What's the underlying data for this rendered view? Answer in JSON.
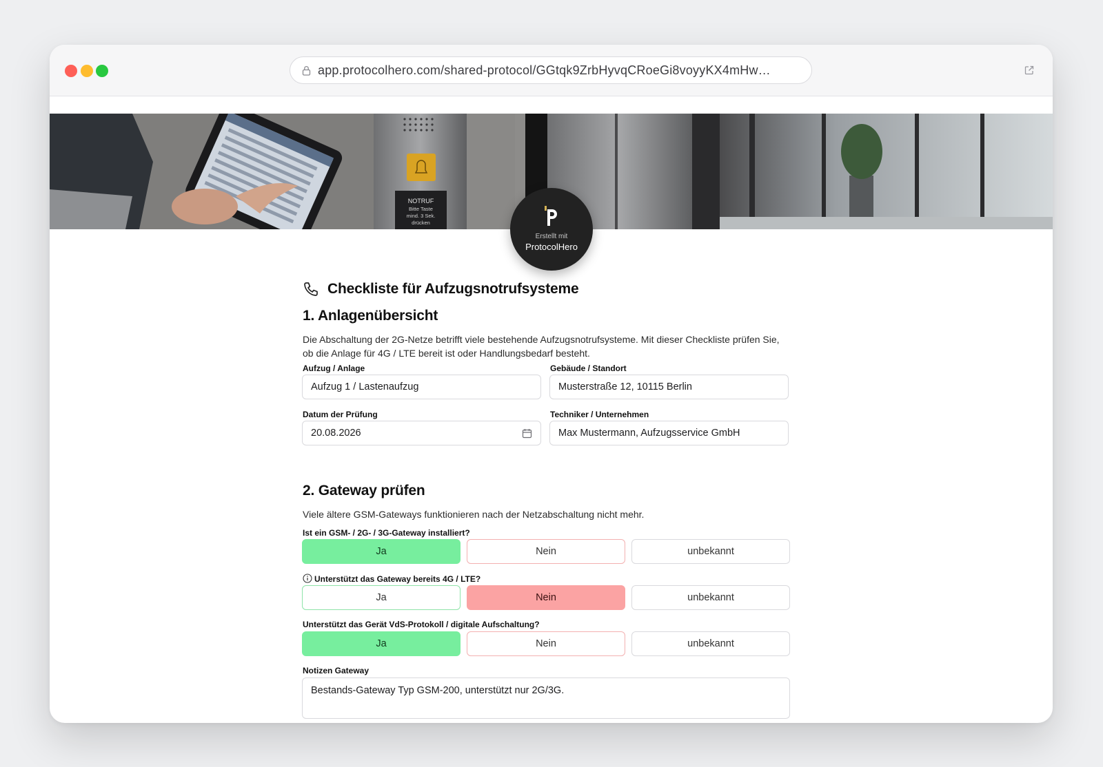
{
  "browser": {
    "url": "app.protocolhero.com/shared-protocol/GGtqk9ZrbHyvqCRoeGi8voyyKX4mHw…"
  },
  "hero": {
    "panel_text": [
      "NOTRUF",
      "Bitte Taste",
      "mind. 3 Sek.",
      "drücken"
    ]
  },
  "logo": {
    "small": "Erstellt mit",
    "name": "ProtocolHero"
  },
  "document": {
    "title": "Checkliste für Aufzugsnotrufsysteme",
    "section1": {
      "title": "1. Anlagenübersicht",
      "description": "Die Abschaltung der 2G-Netze betrifft viele bestehende Aufzugsnotrufsysteme. Mit dieser Checkliste prüfen Sie, ob die Anlage für 4G / LTE bereit ist oder Handlungsbedarf besteht.",
      "fields": {
        "anlage": {
          "label": "Aufzug / Anlage",
          "value": "Aufzug 1 / Lastenaufzug"
        },
        "standort": {
          "label": "Gebäude / Standort",
          "value": "Musterstraße 12, 10115 Berlin"
        },
        "datum": {
          "label": "Datum der Prüfung",
          "value": "20.08.2026"
        },
        "techniker": {
          "label": "Techniker / Unternehmen",
          "value": "Max Mustermann, Aufzugsservice GmbH"
        }
      }
    },
    "section2": {
      "title": "2. Gateway prüfen",
      "description": "Viele ältere GSM-Gateways funktionieren nach der Netzabschaltung nicht mehr.",
      "questions": [
        {
          "label": "Ist ein GSM- / 2G- / 3G-Gateway installiert?",
          "selected": "Ja"
        },
        {
          "label": "Unterstützt das Gateway bereits 4G / LTE?",
          "selected": "Nein"
        },
        {
          "label": "Unterstützt das Gerät VdS-Protokoll / digitale Aufschaltung?",
          "selected": "Ja"
        }
      ],
      "options": {
        "yes": "Ja",
        "no": "Nein",
        "unknown": "unbekannt"
      },
      "notes": {
        "label": "Notizen Gateway",
        "value": "Bestands-Gateway Typ GSM-200, unterstützt nur 2G/3G."
      }
    }
  },
  "colors": {
    "selected_yes": "#77ee9e",
    "selected_no": "#fba3a3",
    "logo_badge": "#222222"
  }
}
